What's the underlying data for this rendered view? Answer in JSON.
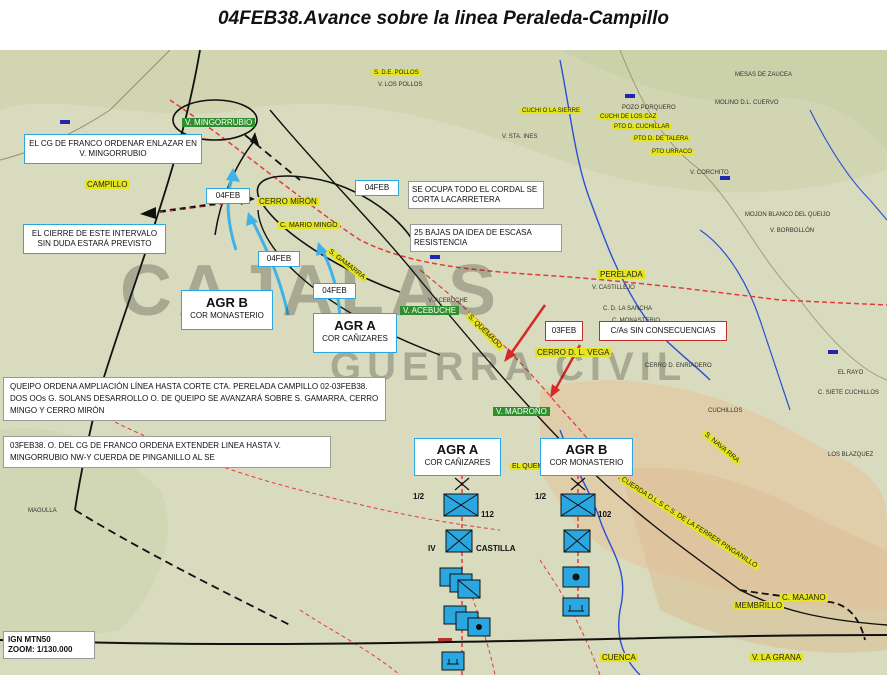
{
  "title": "04FEB38.Avance sobre la linea Peraleda-Campillo",
  "colors": {
    "map_bg": "#d9dcc0",
    "river": "#2a4fd6",
    "road_red": "#e23b3b",
    "arrow_blue": "#3fb2e8",
    "arrow_red": "#d42a2a",
    "unit_blue": "#2aa7e0",
    "front_line": "#111111",
    "highlight": "#e5e51e"
  },
  "callouts": {
    "cg_franco": "EL CG DE FRANCO ORDENAR  ENLAZAR EN V. MINGORRUBIO",
    "cierre": "EL CIERRE DE ESTE INTERVALO SIN DUDA ESTARÁ PREVISTO",
    "cordal": "SE OCUPA TODO EL CORDAL SE CORTA LACARRETERA",
    "bajas": "25 BAJAS DA IDEA DE ESCASA RESISTENCIA",
    "queipo": "QUEIPO ORDENA AMPLIACIÓN LÍNEA HASTA CORTE CTA. PERELADA CAMPILLO 02-03FEB38. DOS OOs G. SOLANS DESARROLLO O. DE QUEIPO SE AVANZARÁ SOBRE S. GAMARRA, CERRO MINGO Y CERRO MIRÓN",
    "extender": "03FEB38. O. DEL CG DE FRANCO ORDENA  EXTENDER LINEA HASTA V. MINGORRUBIO NW-Y CUERDA DE PINGANILLO AL SE",
    "cas_sin": "C/As SIN CONSECUENCIAS",
    "ign_line1": "IGN MTN50",
    "ign_line2": "ZOOM: 1/130.000"
  },
  "date_tags": {
    "d1": "04FEB",
    "d2": "04FEB",
    "d3": "04FEB",
    "d4": "04FEB",
    "d5": "03FEB"
  },
  "groups": {
    "agr_b_map": {
      "title": "AGR B",
      "sub": "COR MONASTERIO"
    },
    "agr_a_map": {
      "title": "AGR A",
      "sub": "COR CAÑIZARES"
    },
    "agr_a_col": {
      "title": "AGR A",
      "sub": "COR CAÑIZARES"
    },
    "agr_b_col": {
      "title": "AGR B",
      "sub": "COR MONASTERIO"
    }
  },
  "units": {
    "frac_a": "1/2",
    "frac_b": "1/2",
    "num_a": "112",
    "num_b": "102",
    "iv": "IV",
    "castilla": "CASTILLA"
  },
  "places_green": {
    "mingorrubio": "V. MINGORRUBIO",
    "madrono": "V. MADROÑO",
    "acebuche": "V. ACEBUCHE"
  },
  "places_hl": {
    "cerro_miron": "CERRO MIRÓN",
    "cerro_mingo": "C. MARIO MINGO",
    "gamarra": "S. GAMARRA",
    "campillo": "CAMPILLO",
    "perelada": "PERELADA",
    "cerro_vega": "CERRO D. L. VEGA",
    "membrillo": "MEMBRILLO",
    "majano": "C. MAJANO",
    "quemado": "S. QUEMADO",
    "cuerda": "CUERDA D.L.S C.S. DE LA FERRER PINGANILLO",
    "navarra": "S. NAVA RRA",
    "el_quemado": "EL QUEMADO",
    "cuenca": "CUENCA",
    "la_grana": "V. LA GRANA"
  },
  "places_small": {
    "los_pollos": "S. D.E. POLLOS",
    "v_los_pollos": "V. LOS POLLOS",
    "mesas": "MESAS DE ZAUCEA",
    "pozo": "POZO PORQUERO",
    "ms_cuervo": "MOLINO D.L. CUERVO",
    "cuchi": "CUCHI O LA SIERRE",
    "cuchi2": "CUCHI DE LOS CAZ",
    "pto_cuchillar": "PTO D. CUCHILLAR",
    "pto_lalera": "PTO D. DE TALERA",
    "pto_urraco": "PTO URRACO",
    "v_staines": "V. STA. INES",
    "v_corchito": "V. CORCHITO",
    "mojon": "MOJON BLANCO DEL QUEIJO",
    "borbollon": "V. BORBOLLÓN",
    "v_castillejo": "V. CASTILLEJO",
    "sancha": "C. D. LA SANCHA",
    "monasterio": "C. MONASTERIO",
    "cerro_enriadero": "CERRO D. ENRIADERO",
    "el_rayo": "EL RAYO",
    "siete": "C. SIETE CUCHILLOS",
    "blazquez": "LOS BLAZQUEZ",
    "cuchillos": "CUCHILLOS",
    "magulla": "MAGULLA",
    "v_acebuche2": "V. ACEBUCHE"
  },
  "watermark": {
    "big": "CAJALAS",
    "small": "GUERRA CIVIL"
  }
}
